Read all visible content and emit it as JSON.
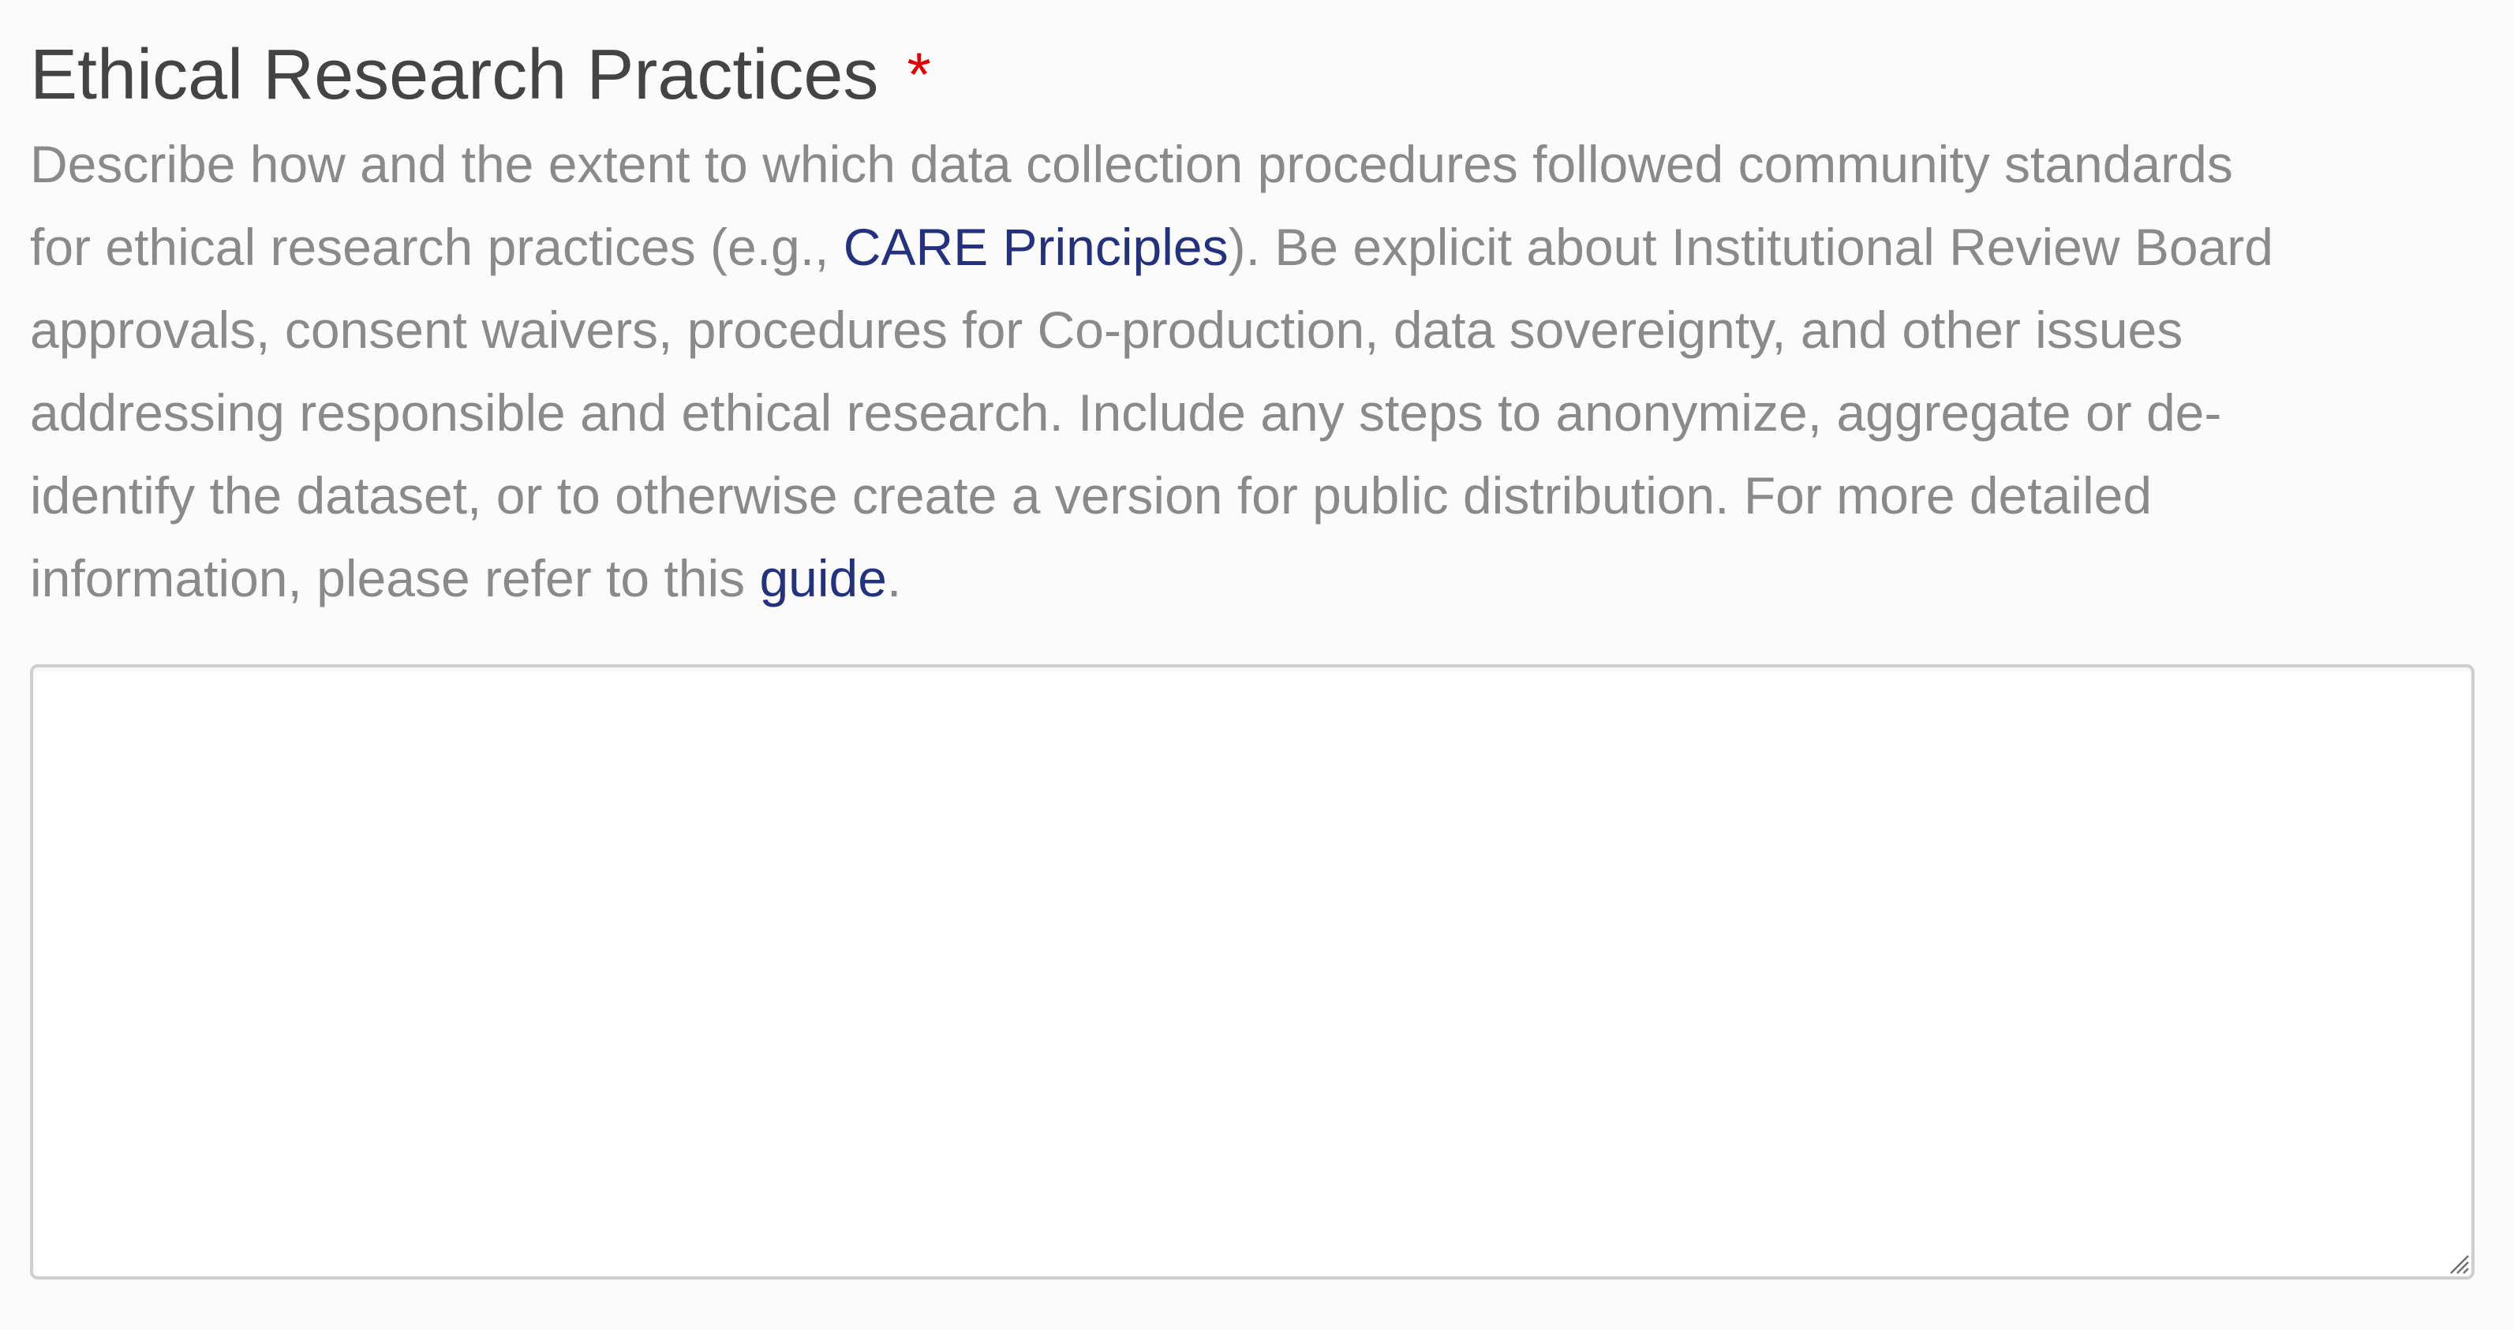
{
  "field": {
    "label": "Ethical Research Practices",
    "required_marker": "*",
    "description": {
      "line1": "Describe how and the extent to which data collection procedures followed community standards",
      "line2_before_link": "for ethical research practices (e.g., ",
      "care_link": "CARE Principles",
      "line2_after_link": "). Be explicit about Institutional Review Board",
      "line3": "approvals, consent waivers, procedures for Co-production, data sovereignty, and other issues",
      "line4": "addressing responsible and ethical research. Include any steps to anonymize, aggregate or de-",
      "line5": "identify the dataset, or to otherwise create a version for public distribution. For more detailed",
      "line6_before_link": "information, please refer to this ",
      "guide_link": "guide",
      "line6_after_link": "."
    },
    "textarea": {
      "value": "",
      "placeholder": ""
    }
  },
  "colors": {
    "background": "#fbfbfb",
    "label_text": "#444444",
    "description_text": "#8a8a8a",
    "link": "#24317e",
    "required": "#e00000",
    "border": "#cfcfcf"
  }
}
